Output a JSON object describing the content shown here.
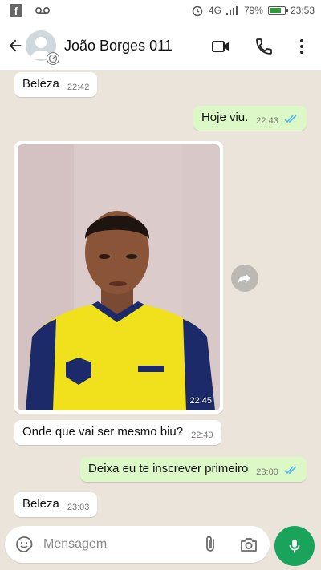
{
  "status_bar": {
    "network": "4G",
    "battery_percent": "79%",
    "time": "23:53",
    "left_icons": [
      "facebook-icon",
      "voicemail-icon"
    ],
    "right_icons": [
      "alarm-icon",
      "signal-icon",
      "battery-icon"
    ]
  },
  "header": {
    "contact_name": "João Borges 011",
    "icons": [
      "back-arrow-icon",
      "video-call-icon",
      "phone-call-icon",
      "more-options-icon"
    ]
  },
  "messages": [
    {
      "direction": "in",
      "text": "Beleza",
      "time": "22:42"
    },
    {
      "direction": "out",
      "text": "Hoje viu.",
      "time": "22:43",
      "read": true
    },
    {
      "direction": "in",
      "type": "image",
      "time": "22:45"
    },
    {
      "direction": "in",
      "text": "Onde que vai ser mesmo biu?",
      "time": "22:49"
    },
    {
      "direction": "out",
      "text": "Deixa eu te inscrever primeiro",
      "time": "23:00",
      "read": true
    },
    {
      "direction": "in",
      "text": "Beleza",
      "time": "23:03"
    }
  ],
  "composer": {
    "placeholder": "Mensagem"
  },
  "colors": {
    "outgoing_bubble": "#dcf8c6",
    "incoming_bubble": "#ffffff",
    "read_ticks": "#4fb6ec",
    "mic_button": "#1aa35b",
    "chat_background": "#ebe4da"
  }
}
